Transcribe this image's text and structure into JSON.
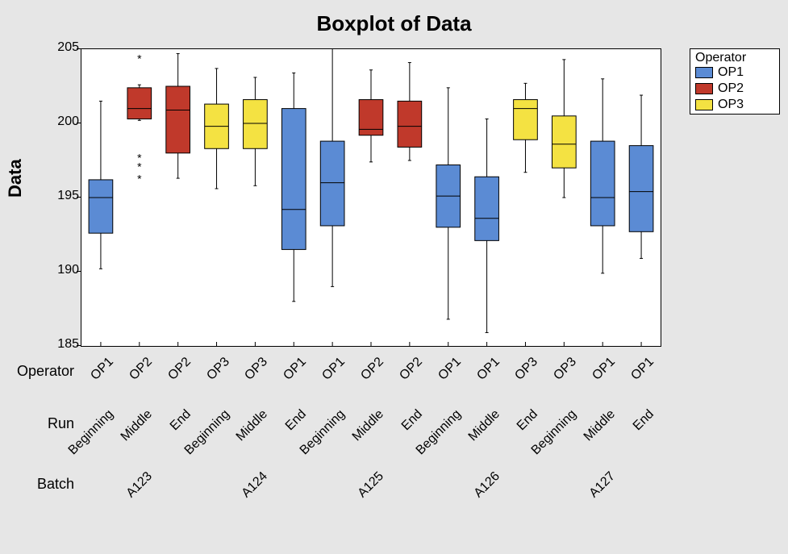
{
  "title": "Boxplot of Data",
  "ylabel": "Data",
  "row_labels": {
    "operator": "Operator",
    "run": "Run",
    "batch": "Batch"
  },
  "y": {
    "min": 185,
    "max": 205,
    "ticks": [
      185,
      190,
      195,
      200,
      205
    ]
  },
  "colors": {
    "OP1": "#5b8bd4",
    "OP2": "#c0392b",
    "OP3": "#f4e242",
    "edge": "#000"
  },
  "legend": {
    "title": "Operator",
    "items": [
      {
        "name": "OP1",
        "color": "#5b8bd4"
      },
      {
        "name": "OP2",
        "color": "#c0392b"
      },
      {
        "name": "OP3",
        "color": "#f4e242"
      }
    ]
  },
  "chart_data": {
    "type": "boxplot",
    "title": "Boxplot of Data",
    "ylabel": "Data",
    "ylim": [
      185,
      205
    ],
    "categories": [
      {
        "batch": "A123",
        "run": "Beginning",
        "operator": "OP1"
      },
      {
        "batch": "A123",
        "run": "Middle",
        "operator": "OP2"
      },
      {
        "batch": "A123",
        "run": "End",
        "operator": "OP2"
      },
      {
        "batch": "A124",
        "run": "Beginning",
        "operator": "OP3"
      },
      {
        "batch": "A124",
        "run": "Middle",
        "operator": "OP3"
      },
      {
        "batch": "A124",
        "run": "End",
        "operator": "OP1"
      },
      {
        "batch": "A125",
        "run": "Beginning",
        "operator": "OP1"
      },
      {
        "batch": "A125",
        "run": "Middle",
        "operator": "OP2"
      },
      {
        "batch": "A125",
        "run": "End",
        "operator": "OP2"
      },
      {
        "batch": "A126",
        "run": "Beginning",
        "operator": "OP1"
      },
      {
        "batch": "A126",
        "run": "Middle",
        "operator": "OP1"
      },
      {
        "batch": "A126",
        "run": "End",
        "operator": "OP3"
      },
      {
        "batch": "A127",
        "run": "Beginning",
        "operator": "OP3"
      },
      {
        "batch": "A127",
        "run": "Middle",
        "operator": "OP1"
      },
      {
        "batch": "A127",
        "run": "End",
        "operator": "OP1"
      }
    ],
    "series": [
      {
        "low": 190.2,
        "q1": 192.6,
        "median": 195.0,
        "q3": 196.2,
        "high": 201.5,
        "outliers": []
      },
      {
        "low": 200.2,
        "q1": 200.3,
        "median": 201.0,
        "q3": 202.4,
        "high": 202.6,
        "outliers": [
          196.2,
          197.0,
          197.6,
          204.3
        ]
      },
      {
        "low": 196.3,
        "q1": 198.0,
        "median": 200.9,
        "q3": 202.5,
        "high": 204.7,
        "outliers": []
      },
      {
        "low": 195.6,
        "q1": 198.3,
        "median": 199.8,
        "q3": 201.3,
        "high": 203.7,
        "outliers": []
      },
      {
        "low": 195.8,
        "q1": 198.3,
        "median": 200.0,
        "q3": 201.6,
        "high": 203.1,
        "outliers": []
      },
      {
        "low": 188.0,
        "q1": 191.5,
        "median": 194.2,
        "q3": 201.0,
        "high": 203.4,
        "outliers": []
      },
      {
        "low": 189.0,
        "q1": 193.1,
        "median": 196.0,
        "q3": 198.8,
        "high": 205.4,
        "outliers": []
      },
      {
        "low": 197.4,
        "q1": 199.2,
        "median": 199.6,
        "q3": 201.6,
        "high": 203.6,
        "outliers": []
      },
      {
        "low": 197.5,
        "q1": 198.4,
        "median": 199.8,
        "q3": 201.5,
        "high": 204.1,
        "outliers": []
      },
      {
        "low": 186.8,
        "q1": 193.0,
        "median": 195.1,
        "q3": 197.2,
        "high": 202.4,
        "outliers": []
      },
      {
        "low": 185.9,
        "q1": 192.1,
        "median": 193.6,
        "q3": 196.4,
        "high": 200.3,
        "outliers": []
      },
      {
        "low": 196.7,
        "q1": 198.9,
        "median": 201.0,
        "q3": 201.6,
        "high": 202.7,
        "outliers": []
      },
      {
        "low": 195.0,
        "q1": 197.0,
        "median": 198.6,
        "q3": 200.5,
        "high": 204.3,
        "outliers": []
      },
      {
        "low": 189.9,
        "q1": 193.1,
        "median": 195.0,
        "q3": 198.8,
        "high": 203.0,
        "outliers": []
      },
      {
        "low": 190.9,
        "q1": 192.7,
        "median": 195.4,
        "q3": 198.5,
        "high": 201.9,
        "outliers": []
      }
    ]
  }
}
